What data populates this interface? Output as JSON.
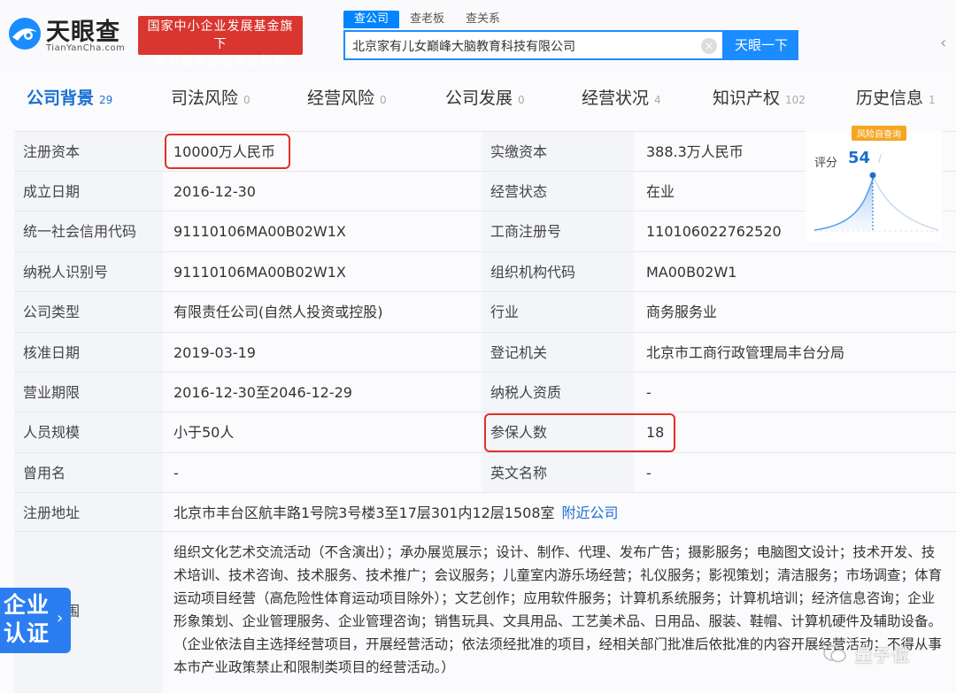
{
  "header": {
    "logo_text": "天眼查",
    "logo_sub": "TianYanCha.com",
    "badge_line1": "国家中小企业发展基金旗下",
    "badge_line2": "官方备案企业征信机构"
  },
  "search": {
    "tabs": [
      "查公司",
      "查老板",
      "查关系"
    ],
    "value": "北京家有儿女巅峰大脑教育科技有限公司",
    "button": "天眼一下",
    "clear_icon": "close-icon"
  },
  "tabs": [
    {
      "label": "公司背景",
      "count": "29"
    },
    {
      "label": "司法风险",
      "count": "0"
    },
    {
      "label": "经营风险",
      "count": "0"
    },
    {
      "label": "公司发展",
      "count": "0"
    },
    {
      "label": "经营状况",
      "count": "4"
    },
    {
      "label": "知识产权",
      "count": "102"
    },
    {
      "label": "历史信息",
      "count": "1"
    }
  ],
  "rows": [
    {
      "l1": "注册资本",
      "v1": "10000万人民币",
      "l2": "实缴资本",
      "v2": "388.3万人民币"
    },
    {
      "l1": "成立日期",
      "v1": "2016-12-30",
      "l2": "经营状态",
      "v2": "在业"
    },
    {
      "l1": "统一社会信用代码",
      "v1": "91110106MA00B02W1X",
      "l2": "工商注册号",
      "v2": "110106022762520"
    },
    {
      "l1": "纳税人识别号",
      "v1": "91110106MA00B02W1X",
      "l2": "组织机构代码",
      "v2": "MA00B02W1"
    },
    {
      "l1": "公司类型",
      "v1": "有限责任公司(自然人投资或控股)",
      "l2": "行业",
      "v2": "商务服务业"
    },
    {
      "l1": "核准日期",
      "v1": "2019-03-19",
      "l2": "登记机关",
      "v2": "北京市工商行政管理局丰台分局"
    },
    {
      "l1": "营业期限",
      "v1": "2016-12-30至2046-12-29",
      "l2": "纳税人资质",
      "v2": "-"
    },
    {
      "l1": "人员规模",
      "v1": "小于50人",
      "l2": "参保人数",
      "v2": "18"
    },
    {
      "l1": "曾用名",
      "v1": "-",
      "l2": "英文名称",
      "v2": "-"
    }
  ],
  "address": {
    "label": "注册地址",
    "value": "北京市丰台区航丰路1号院3号楼3至17层301内12层1508室",
    "link": "附近公司"
  },
  "score": {
    "tag": "风险自查询",
    "label": "评分",
    "value": "54",
    "fade": "/"
  },
  "scope": {
    "label": "围",
    "text": "组织文化艺术交流活动（不含演出）；承办展览展示；设计、制作、代理、发布广告；摄影服务；电脑图文设计；技术开发、技术培训、技术咨询、技术服务、技术推广；会议服务；儿童室内游乐场经营；礼仪服务；影视策划；清洁服务；市场调查；体育运动项目经营（高危险性体育运动项目除外）；文艺创作；应用软件服务；计算机系统服务；计算机培训；经济信息咨询；企业形象策划、企业管理服务、企业管理咨询；销售玩具、文具用品、工艺美术品、日用品、服装、鞋帽、计算机硬件及辅助设备。（企业依法自主选择经营项目，开展经营活动；依法须经批准的项目，经相关部门批准后依批准的内容开展经营活动；不得从事本市产业政策禁止和限制类项目的经营活动。）"
  },
  "cert": {
    "text": "企业认证",
    "arrow": "›"
  },
  "watermark": {
    "text": "量子位"
  },
  "colors": {
    "brand_blue": "#1a8cff",
    "tab_active": "#1a6fd0",
    "highlight_red": "#e0302a",
    "badge_red": "#d9362f"
  }
}
